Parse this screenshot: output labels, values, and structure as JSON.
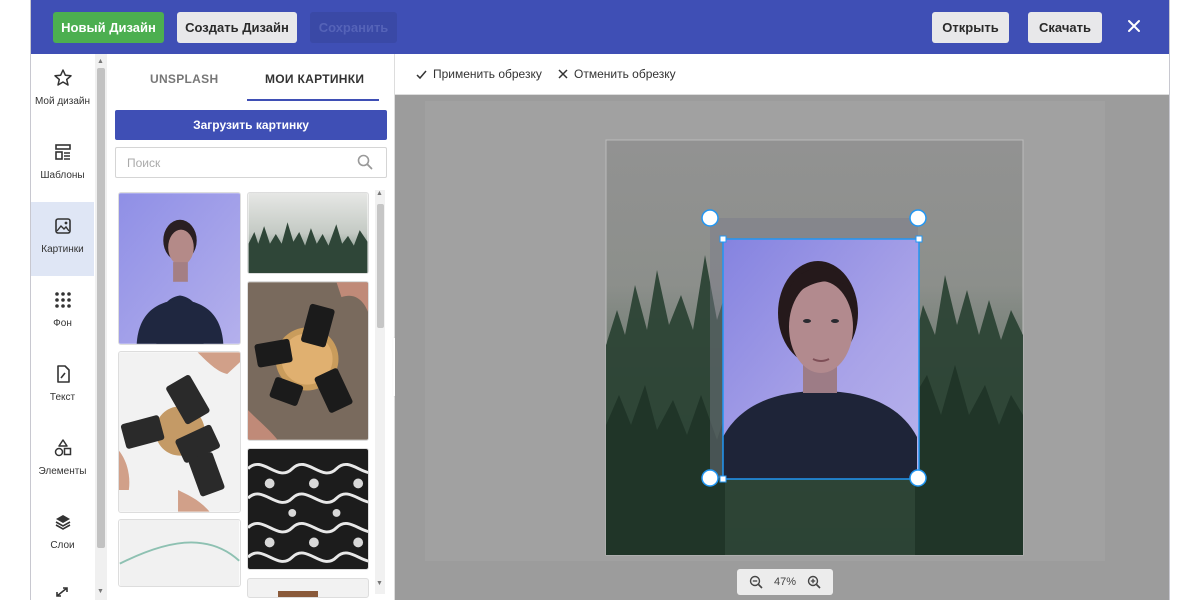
{
  "topbar": {
    "new_design": "Новый Дизайн",
    "create_design": "Создать Дизайн",
    "save": "Сохранить",
    "open": "Открыть",
    "download": "Скачать",
    "close_icon": "close-icon"
  },
  "rail": {
    "items": [
      {
        "label": "Мой дизайн",
        "icon": "star-icon"
      },
      {
        "label": "Шаблоны",
        "icon": "templates-icon"
      },
      {
        "label": "Картинки",
        "icon": "image-icon",
        "active": true
      },
      {
        "label": "Фон",
        "icon": "dots-grid-icon"
      },
      {
        "label": "Текст",
        "icon": "text-file-icon"
      },
      {
        "label": "Элементы",
        "icon": "shapes-icon"
      },
      {
        "label": "Слои",
        "icon": "layers-icon"
      }
    ]
  },
  "panel": {
    "tabs": [
      "UNSPLASH",
      "МОИ КАРТИНКИ"
    ],
    "active_tab": "МОИ КАРТИНКИ",
    "upload_label": "Загрузить картинку",
    "search_placeholder": "Поиск"
  },
  "crop": {
    "apply": "Применить обрезку",
    "cancel": "Отменить обрезку"
  },
  "zoom": {
    "level": "47%"
  },
  "colors": {
    "primary": "#3f4fb5",
    "success": "#4caf50",
    "selection": "#2196f3"
  }
}
